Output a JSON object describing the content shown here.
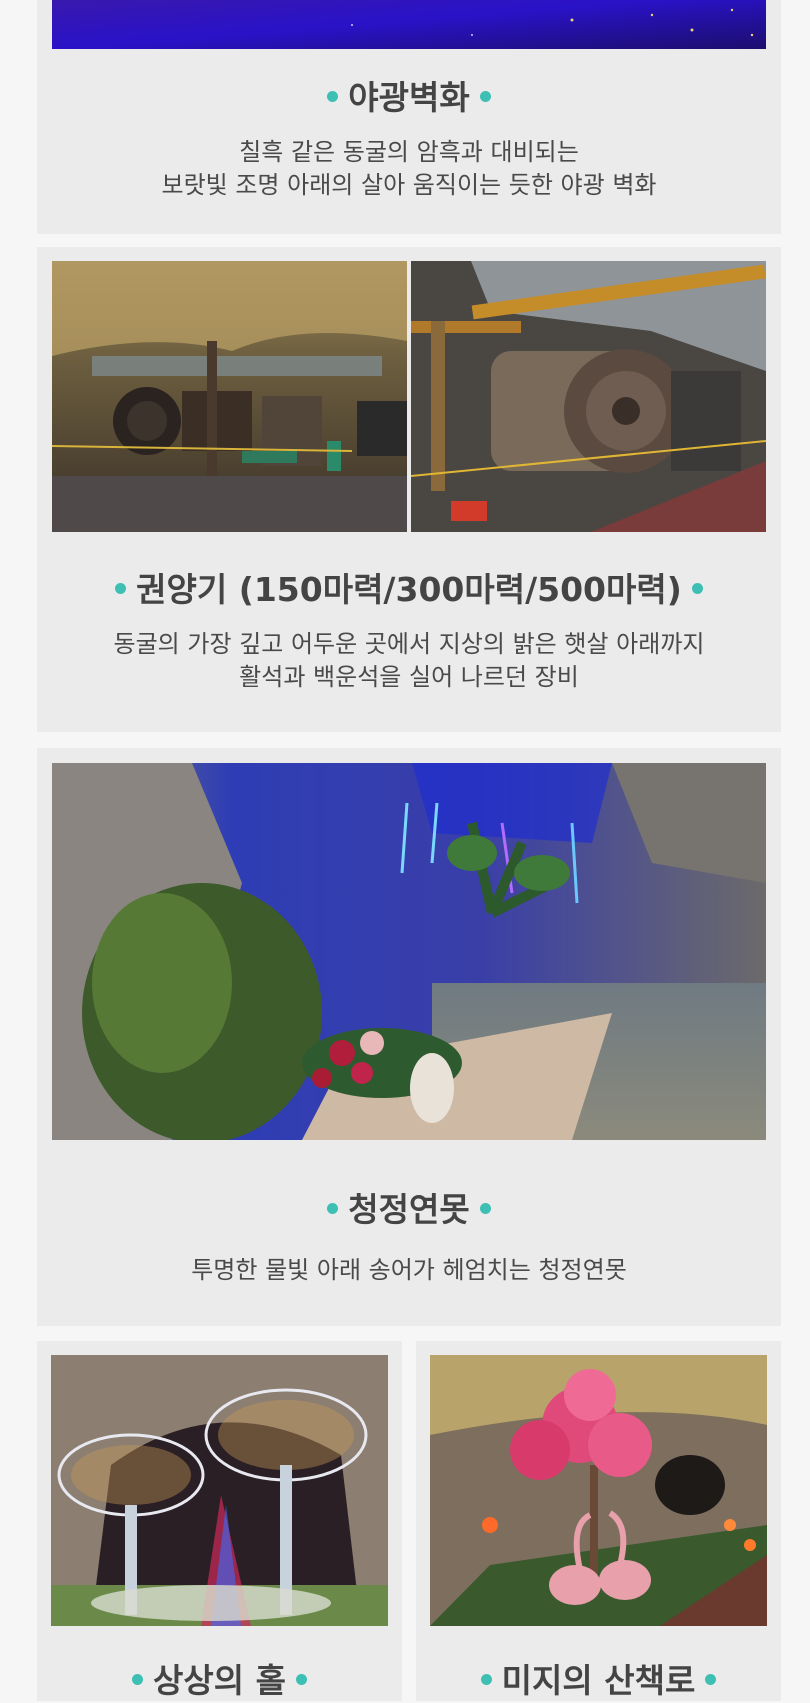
{
  "accent_color": "#3dbfb3",
  "sections": [
    {
      "title": "야광벽화",
      "desc_lines": [
        "칠흑 같은 동굴의 암흑과 대비되는",
        "보랏빛 조명 아래의 살아 움직이는 듯한 야광 벽화"
      ]
    },
    {
      "title": "권양기 (150마력/300마력/500마력)",
      "desc_lines": [
        "동굴의 가장 깊고 어두운 곳에서 지상의 밝은 햇살 아래까지",
        "활석과 백운석을 실어 나르던 장비"
      ]
    },
    {
      "title": "청정연못",
      "desc_lines": [
        "투명한 물빛 아래 송어가 헤엄치는 청정연못"
      ]
    },
    {
      "title": "상상의 홀"
    },
    {
      "title": "미지의 산책로"
    }
  ],
  "images": {
    "glow_mural": "glow-mural-photo",
    "hoist_left": "hoist-machinery-photo",
    "hoist_right": "hoist-drum-photo",
    "pond": "clear-pond-photo",
    "imagination_hall": "imagination-hall-photo",
    "mystery_trail": "mystery-trail-photo"
  }
}
